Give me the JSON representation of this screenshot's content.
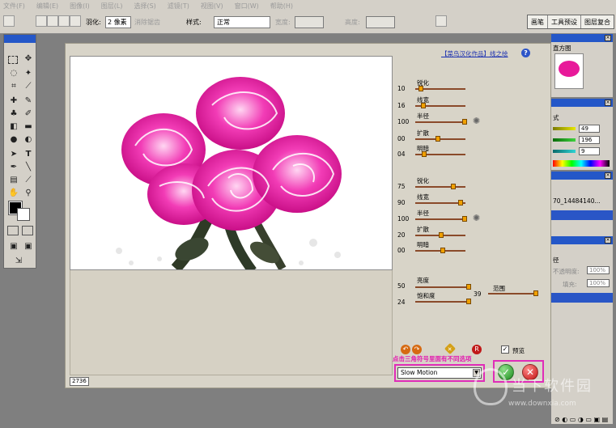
{
  "menubar": [
    "文件(F)",
    "编辑(E)",
    "图像(I)",
    "图层(L)",
    "选择(S)",
    "滤镜(T)",
    "视图(V)",
    "窗口(W)",
    "帮助(H)"
  ],
  "options": {
    "feather_label": "羽化:",
    "feather_value": "2 像素",
    "antialias_label": "消除锯齿",
    "style_label": "样式:",
    "style_value": "正常",
    "width_label": "宽度:",
    "height_label": "高度:"
  },
  "panel_well": [
    "画笔",
    "工具预设",
    "图层复合"
  ],
  "dialog": {
    "credit": "【菜鸟汉化作品】线之绘",
    "help": "?",
    "status_value": "2736",
    "group1": {
      "rows": [
        {
          "label": "锐化",
          "value": "10",
          "pos": 0.11
        },
        {
          "label": "线宽",
          "value": "16",
          "pos": 0.16
        },
        {
          "label": "半径",
          "value": "100",
          "pos": 0.98
        },
        {
          "label": "扩散",
          "value": "00",
          "pos": 0.45
        },
        {
          "label": "明暗",
          "value": "04",
          "pos": 0.18
        }
      ]
    },
    "group2": {
      "rows": [
        {
          "label": "锐化",
          "value": "75",
          "pos": 0.76
        },
        {
          "label": "线宽",
          "value": "90",
          "pos": 0.91
        },
        {
          "label": "半径",
          "value": "100",
          "pos": 0.98
        },
        {
          "label": "扩散",
          "value": "20",
          "pos": 0.52
        },
        {
          "label": "明暗",
          "value": "00",
          "pos": 0.55
        }
      ]
    },
    "group3": {
      "brightness_label": "亮度",
      "brightness_value": "50",
      "brightness_pos": 0.97,
      "saturation_label": "饱和度",
      "saturation_value": "24",
      "saturation_pos": 0.97,
      "range_label": "范围",
      "range_value": "39",
      "range_pos": 0.95
    },
    "preview_label": "预览",
    "preview_checked": "✓",
    "hint": "点击三角符号里面有不同选项",
    "effect_select": "Slow Motion",
    "ok": "✓",
    "cancel": "✕"
  },
  "right_panels": {
    "histogram_tab": "直方图",
    "color_tab": "式",
    "color_values": [
      "49",
      "196",
      "9"
    ],
    "history_item": "70_14484140...",
    "layers_tab": "径",
    "opacity_label": "不透明度:",
    "opacity_value": "100%",
    "fill_label": "填充:",
    "fill_value": "100%"
  },
  "watermark": {
    "title": "当下软件园",
    "url": "www.downxia.com"
  },
  "colors": {
    "title_blue": "#2457c8",
    "hint_magenta": "#e21cb0",
    "highlight_box": "#e02cb8",
    "rose": "#e8199a"
  }
}
